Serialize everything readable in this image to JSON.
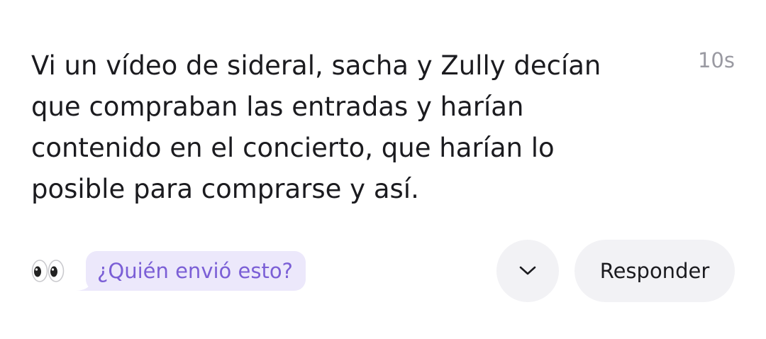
{
  "message": {
    "text": "Vi un vídeo de sideral, sacha y Zully decían que compraban las entradas y harían contenido en el concierto, que harían lo posible para comprarse y así.",
    "timestamp": "10s"
  },
  "footer": {
    "eyes_icon": "eyes-emoji",
    "who_sent_label": "¿Quién envió esto?",
    "expand_icon": "chevron-down-icon",
    "reply_label": "Responder"
  },
  "colors": {
    "text": "#1b1b1f",
    "timestamp": "#9a9aa2",
    "who_sent_bg": "#ece8fb",
    "who_sent_text": "#7b5fd6",
    "button_bg": "#f2f2f5"
  }
}
